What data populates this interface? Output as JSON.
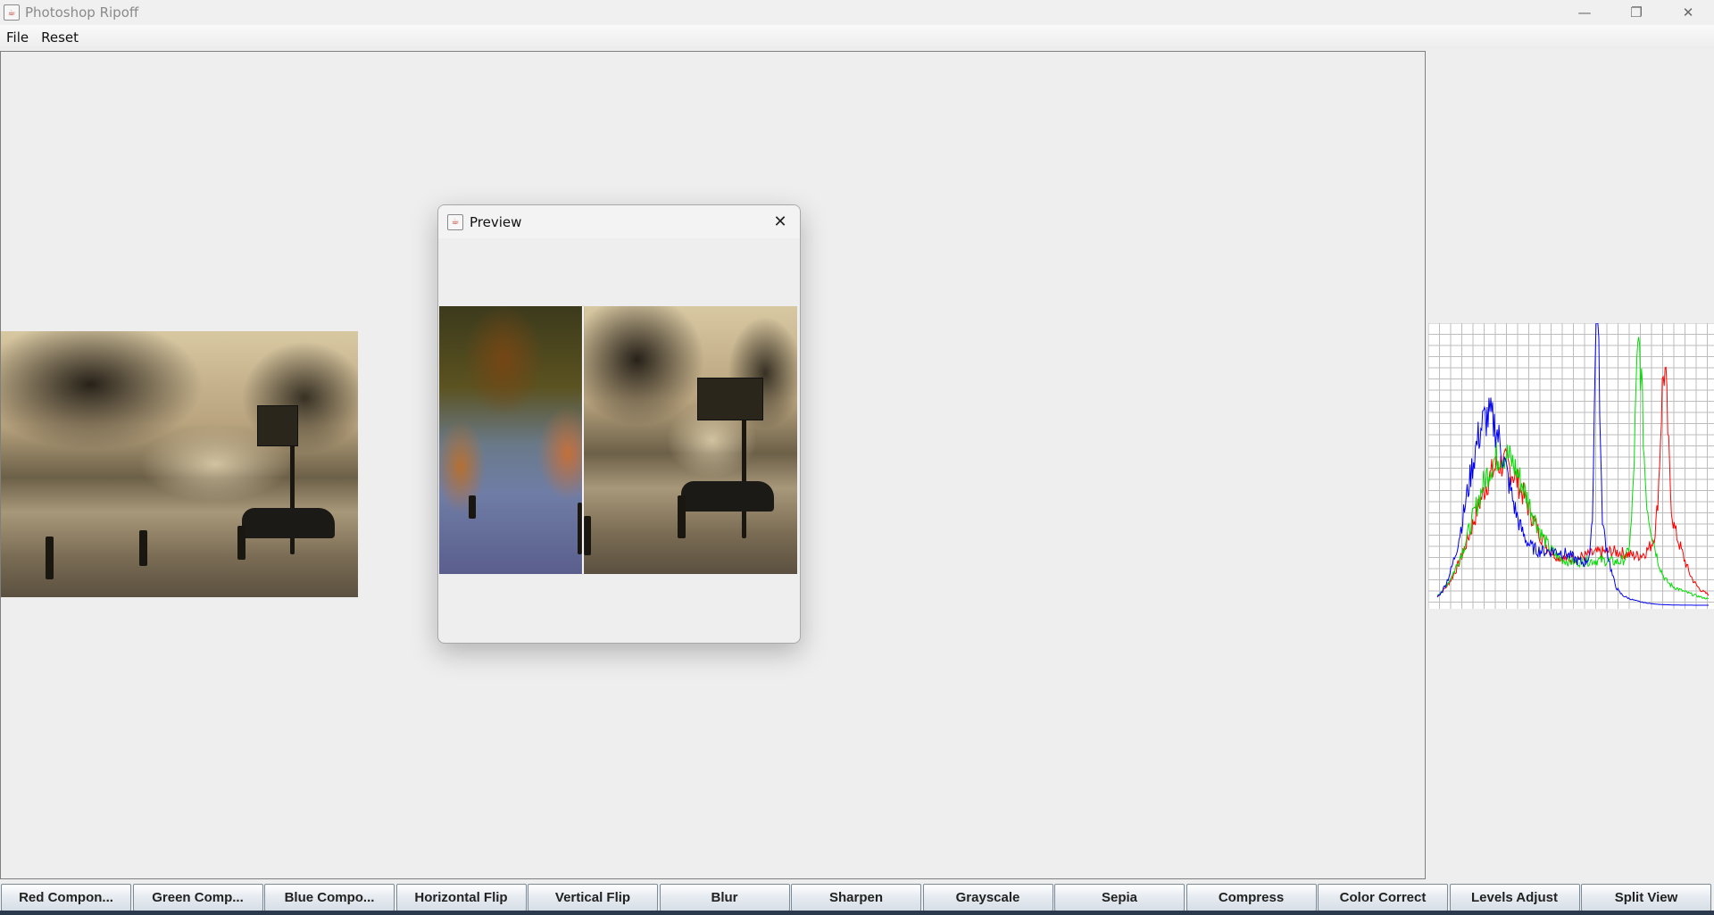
{
  "window": {
    "title": "Photoshop Ripoff",
    "minimize_icon": "minimize-icon",
    "maximize_icon": "restore-icon",
    "close_icon": "close-icon"
  },
  "menu": {
    "items": [
      "File",
      "Reset"
    ]
  },
  "preview_dialog": {
    "title": "Preview",
    "close_icon": "close-icon"
  },
  "histogram": {
    "colors": {
      "red": "#ff0000",
      "green": "#00dd00",
      "blue": "#0000ee"
    }
  },
  "toolbar": {
    "buttons": [
      "Red Compon...",
      "Green Comp...",
      "Blue Compo...",
      "Horizontal Flip",
      "Vertical Flip",
      "Blur",
      "Sharpen",
      "Grayscale",
      "Sepia",
      "Compress",
      "Color Correct",
      "Levels Adjust",
      "Split View"
    ]
  }
}
